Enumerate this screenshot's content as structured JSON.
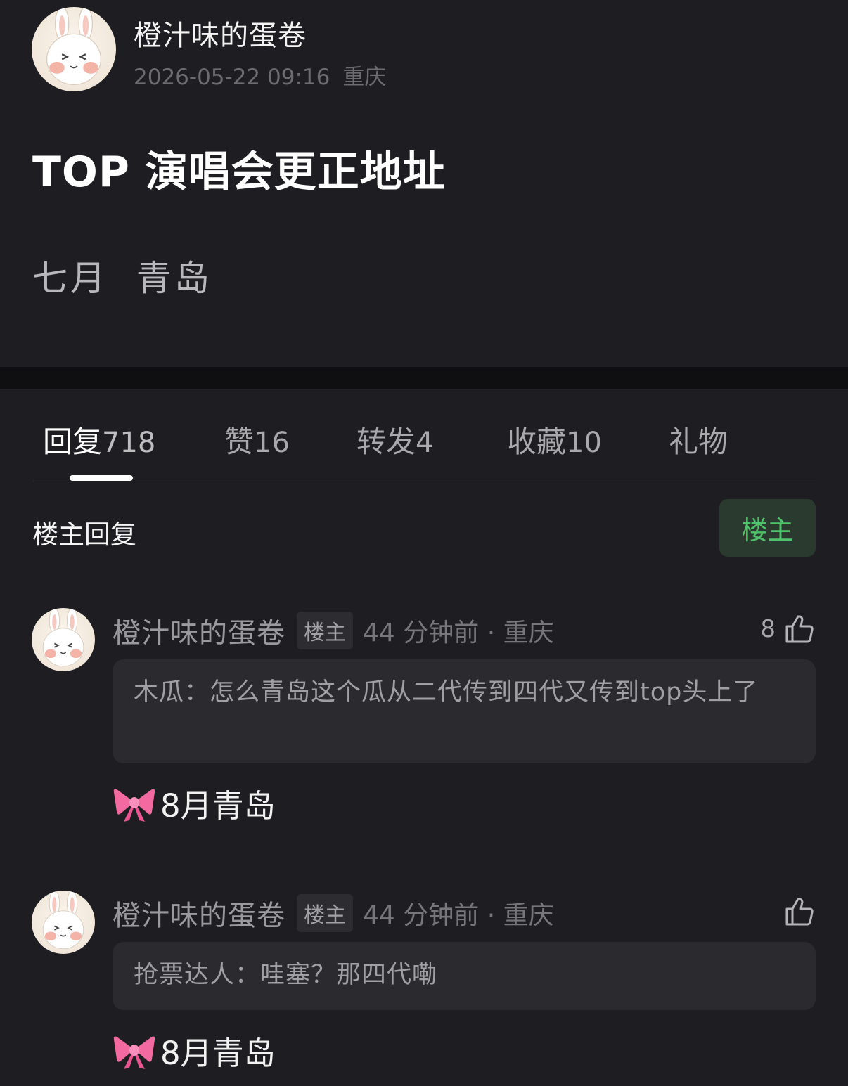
{
  "post": {
    "author": "橙汁味的蛋卷",
    "datetime": "2026-05-22 09:16",
    "location": "重庆",
    "title": "TOP 演唱会更正地址",
    "body": "七月  青岛"
  },
  "tabs": [
    {
      "label": "回复",
      "count": "718",
      "active": true
    },
    {
      "label": "赞",
      "count": "16"
    },
    {
      "label": "转发",
      "count": "4"
    },
    {
      "label": "收藏",
      "count": "10"
    },
    {
      "label": "礼物",
      "count": ""
    }
  ],
  "section": {
    "title": "楼主回复",
    "filter_label": "楼主"
  },
  "comments": [
    {
      "author": "橙汁味的蛋卷",
      "badge": "楼主",
      "time": "44 分钟前 · 重庆",
      "likes": "8",
      "quote": "木瓜：怎么青岛这个瓜从二代传到四代又传到top头上了",
      "reply_icon": "ribbon-bow-icon",
      "reply": "8月青岛"
    },
    {
      "author": "橙汁味的蛋卷",
      "badge": "楼主",
      "time": "44 分钟前 · 重庆",
      "likes": "",
      "quote": "抢票达人：哇塞？那四代嘞",
      "reply_icon": "ribbon-bow-icon",
      "reply": "8月青岛"
    }
  ],
  "colors": {
    "background": "#1e1e22",
    "op_badge_text": "#4fc36a",
    "op_badge_bg": "#2a3a2e",
    "bow": "#f26aa0"
  }
}
